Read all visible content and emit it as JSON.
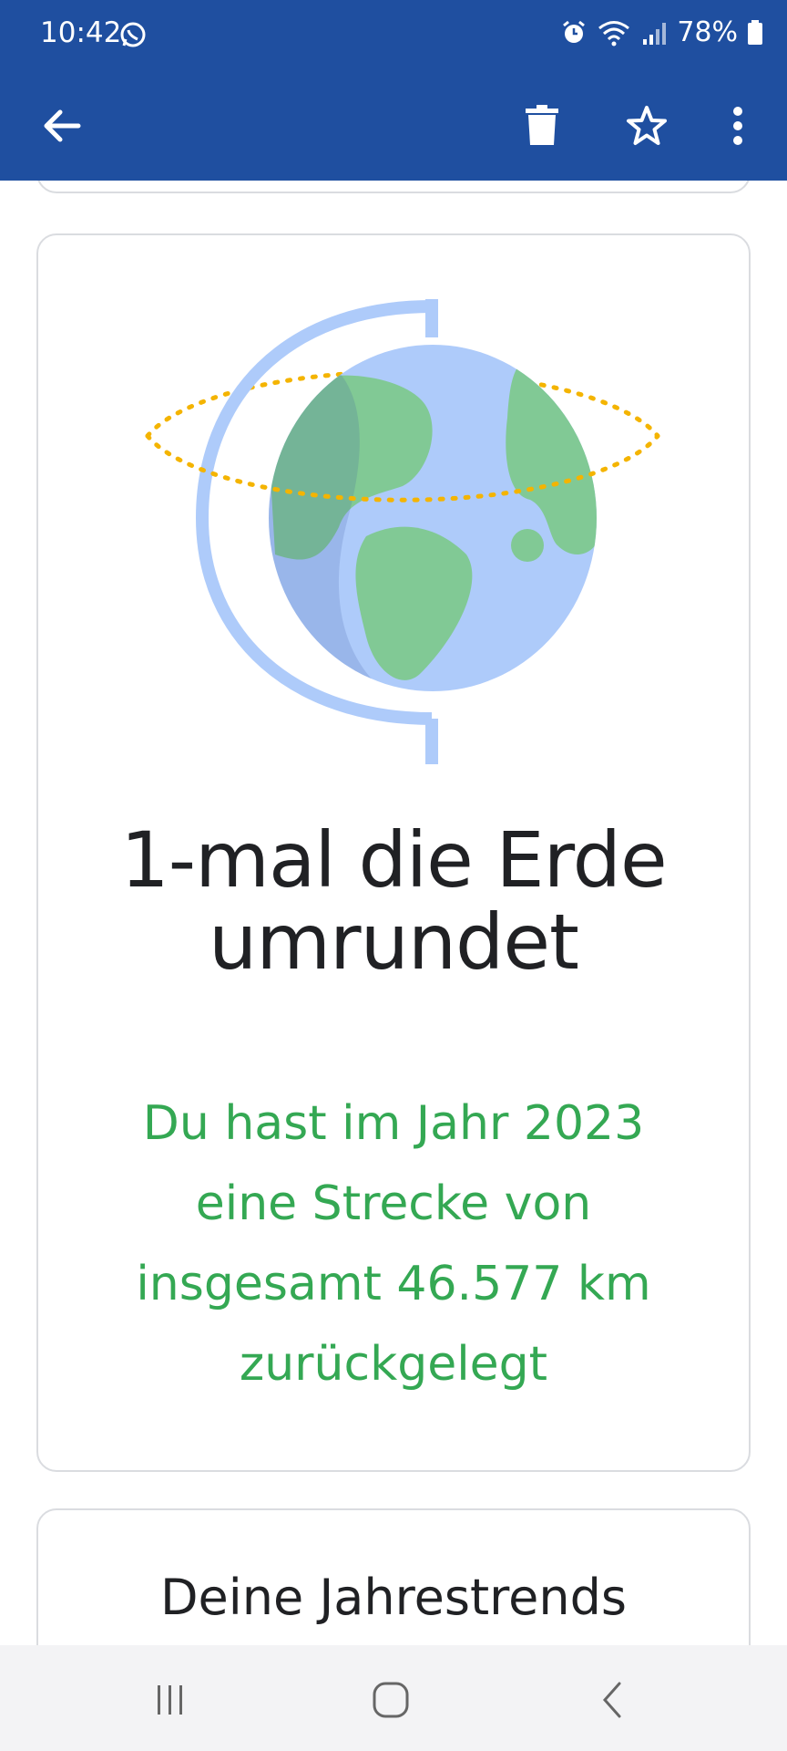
{
  "status_bar": {
    "time": "10:42",
    "battery": "78%",
    "icons": [
      "whatsapp-icon",
      "alarm-icon",
      "wifi-icon",
      "signal-icon",
      "battery-icon"
    ]
  },
  "app_bar": {
    "icons": [
      "back-arrow-icon",
      "delete-icon",
      "star-icon",
      "more-vert-icon"
    ]
  },
  "main": {
    "headline": "1-mal die Erde umrundet",
    "subtext": "Du hast im Jahr 2023 eine Strecke von insgesamt 46.577 km zurückgelegt",
    "trends_title": "Deine Jahrestrends"
  },
  "nav_bar": {
    "icons": [
      "recents-icon",
      "home-icon",
      "back-icon"
    ]
  },
  "colors": {
    "bar": "#1f4fa0",
    "accent_green": "#34a853",
    "orbit": "#f4b400",
    "globe_water": "#aecbfa",
    "globe_land": "#81c995",
    "stand": "#4285f4"
  }
}
